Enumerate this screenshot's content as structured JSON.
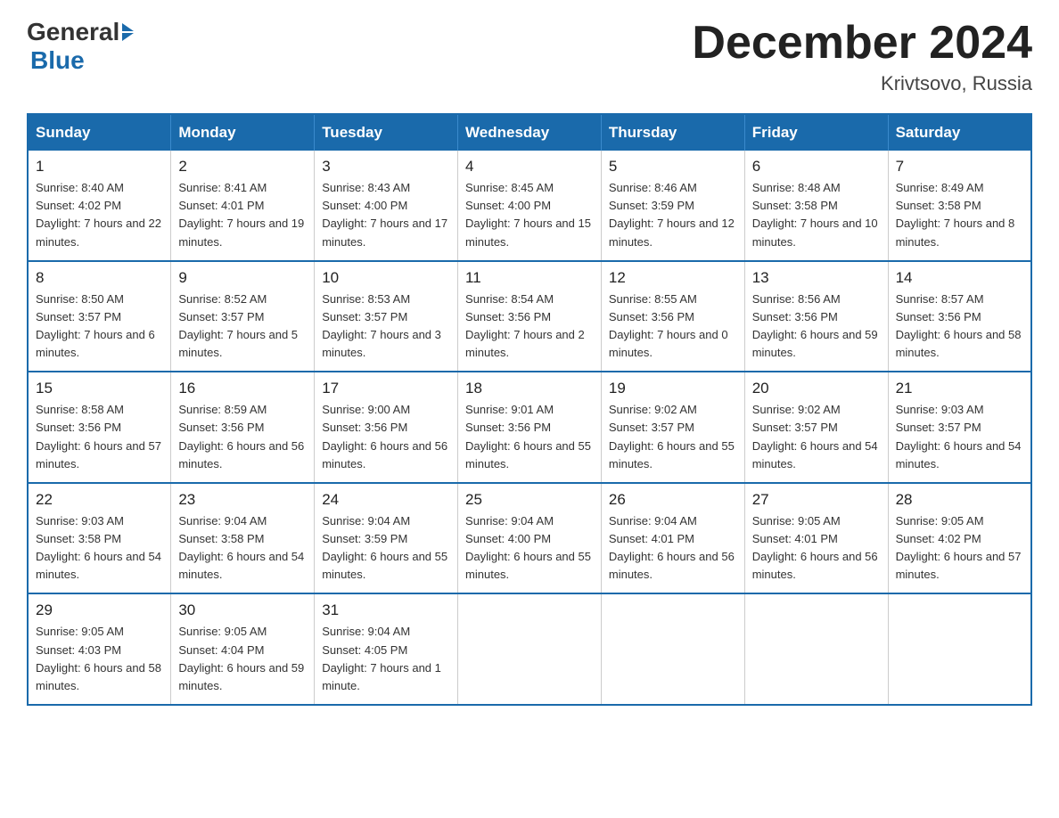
{
  "header": {
    "logo": {
      "general": "General",
      "blue": "Blue"
    },
    "title": "December 2024",
    "location": "Krivtsovo, Russia"
  },
  "calendar": {
    "days_of_week": [
      "Sunday",
      "Monday",
      "Tuesday",
      "Wednesday",
      "Thursday",
      "Friday",
      "Saturday"
    ],
    "weeks": [
      [
        {
          "day": "1",
          "sunrise": "8:40 AM",
          "sunset": "4:02 PM",
          "daylight": "7 hours and 22 minutes."
        },
        {
          "day": "2",
          "sunrise": "8:41 AM",
          "sunset": "4:01 PM",
          "daylight": "7 hours and 19 minutes."
        },
        {
          "day": "3",
          "sunrise": "8:43 AM",
          "sunset": "4:00 PM",
          "daylight": "7 hours and 17 minutes."
        },
        {
          "day": "4",
          "sunrise": "8:45 AM",
          "sunset": "4:00 PM",
          "daylight": "7 hours and 15 minutes."
        },
        {
          "day": "5",
          "sunrise": "8:46 AM",
          "sunset": "3:59 PM",
          "daylight": "7 hours and 12 minutes."
        },
        {
          "day": "6",
          "sunrise": "8:48 AM",
          "sunset": "3:58 PM",
          "daylight": "7 hours and 10 minutes."
        },
        {
          "day": "7",
          "sunrise": "8:49 AM",
          "sunset": "3:58 PM",
          "daylight": "7 hours and 8 minutes."
        }
      ],
      [
        {
          "day": "8",
          "sunrise": "8:50 AM",
          "sunset": "3:57 PM",
          "daylight": "7 hours and 6 minutes."
        },
        {
          "day": "9",
          "sunrise": "8:52 AM",
          "sunset": "3:57 PM",
          "daylight": "7 hours and 5 minutes."
        },
        {
          "day": "10",
          "sunrise": "8:53 AM",
          "sunset": "3:57 PM",
          "daylight": "7 hours and 3 minutes."
        },
        {
          "day": "11",
          "sunrise": "8:54 AM",
          "sunset": "3:56 PM",
          "daylight": "7 hours and 2 minutes."
        },
        {
          "day": "12",
          "sunrise": "8:55 AM",
          "sunset": "3:56 PM",
          "daylight": "7 hours and 0 minutes."
        },
        {
          "day": "13",
          "sunrise": "8:56 AM",
          "sunset": "3:56 PM",
          "daylight": "6 hours and 59 minutes."
        },
        {
          "day": "14",
          "sunrise": "8:57 AM",
          "sunset": "3:56 PM",
          "daylight": "6 hours and 58 minutes."
        }
      ],
      [
        {
          "day": "15",
          "sunrise": "8:58 AM",
          "sunset": "3:56 PM",
          "daylight": "6 hours and 57 minutes."
        },
        {
          "day": "16",
          "sunrise": "8:59 AM",
          "sunset": "3:56 PM",
          "daylight": "6 hours and 56 minutes."
        },
        {
          "day": "17",
          "sunrise": "9:00 AM",
          "sunset": "3:56 PM",
          "daylight": "6 hours and 56 minutes."
        },
        {
          "day": "18",
          "sunrise": "9:01 AM",
          "sunset": "3:56 PM",
          "daylight": "6 hours and 55 minutes."
        },
        {
          "day": "19",
          "sunrise": "9:02 AM",
          "sunset": "3:57 PM",
          "daylight": "6 hours and 55 minutes."
        },
        {
          "day": "20",
          "sunrise": "9:02 AM",
          "sunset": "3:57 PM",
          "daylight": "6 hours and 54 minutes."
        },
        {
          "day": "21",
          "sunrise": "9:03 AM",
          "sunset": "3:57 PM",
          "daylight": "6 hours and 54 minutes."
        }
      ],
      [
        {
          "day": "22",
          "sunrise": "9:03 AM",
          "sunset": "3:58 PM",
          "daylight": "6 hours and 54 minutes."
        },
        {
          "day": "23",
          "sunrise": "9:04 AM",
          "sunset": "3:58 PM",
          "daylight": "6 hours and 54 minutes."
        },
        {
          "day": "24",
          "sunrise": "9:04 AM",
          "sunset": "3:59 PM",
          "daylight": "6 hours and 55 minutes."
        },
        {
          "day": "25",
          "sunrise": "9:04 AM",
          "sunset": "4:00 PM",
          "daylight": "6 hours and 55 minutes."
        },
        {
          "day": "26",
          "sunrise": "9:04 AM",
          "sunset": "4:01 PM",
          "daylight": "6 hours and 56 minutes."
        },
        {
          "day": "27",
          "sunrise": "9:05 AM",
          "sunset": "4:01 PM",
          "daylight": "6 hours and 56 minutes."
        },
        {
          "day": "28",
          "sunrise": "9:05 AM",
          "sunset": "4:02 PM",
          "daylight": "6 hours and 57 minutes."
        }
      ],
      [
        {
          "day": "29",
          "sunrise": "9:05 AM",
          "sunset": "4:03 PM",
          "daylight": "6 hours and 58 minutes."
        },
        {
          "day": "30",
          "sunrise": "9:05 AM",
          "sunset": "4:04 PM",
          "daylight": "6 hours and 59 minutes."
        },
        {
          "day": "31",
          "sunrise": "9:04 AM",
          "sunset": "4:05 PM",
          "daylight": "7 hours and 1 minute."
        },
        null,
        null,
        null,
        null
      ]
    ]
  }
}
